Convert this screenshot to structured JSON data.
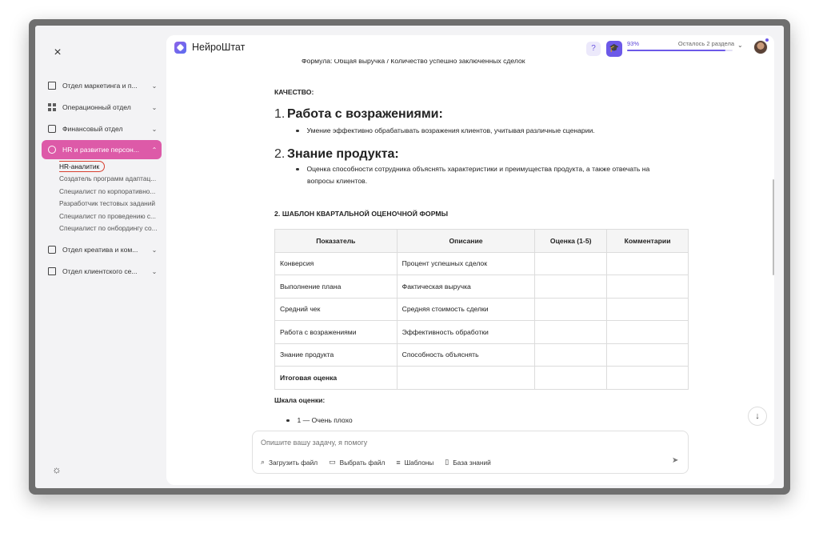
{
  "sidebar": {
    "close_icon": "×",
    "items": [
      {
        "label": "Отдел маркетинга и п...",
        "icon": "shop-icon"
      },
      {
        "label": "Операционный отдел",
        "icon": "grid-icon"
      },
      {
        "label": "Финансовый отдел",
        "icon": "wallet-icon"
      },
      {
        "label": "HR и развитие персон...",
        "icon": "users-icon",
        "active": true
      },
      {
        "label": "Отдел креатива и ком...",
        "icon": "chat-icon"
      },
      {
        "label": "Отдел клиентского се...",
        "icon": "card-icon"
      }
    ],
    "sub_items": [
      "HR-аналитик",
      "Создатель программ адаптац...",
      "Специалист по корпоративно...",
      "Разработчик тестовых заданий",
      "Специалист по проведению с...",
      "Специалист по онбордингу со..."
    ]
  },
  "topbar": {
    "brand": "НейроШтат",
    "progress_pct": "93%",
    "progress_value": 0.93,
    "progress_left": "Осталось 2 раздела"
  },
  "content": {
    "cut_line": "Формула: Общая выручка / Количество успешно заключенных сделок",
    "quality_heading": "КАЧЕСТВО:",
    "item1_num": "1.",
    "item1_title": "Работа с возражениями:",
    "item1_bullet": "Умение эффективно обрабатывать возражения клиентов, учитывая различные сценарии.",
    "item2_num": "2.",
    "item2_title": "Знание продукта:",
    "item2_bullet_line1": "Оценка способности сотрудника объяснять характеристики и преимущества продукта, а также отвечать на",
    "item2_bullet_line2": "вопросы клиентов.",
    "section_heading": "2. ШАБЛОН КВАРТАЛЬНОЙ ОЦЕНОЧНОЙ ФОРМЫ",
    "table": {
      "headers": [
        "Показатель",
        "Описание",
        "Оценка (1-5)",
        "Комментарии"
      ],
      "rows": [
        [
          "Конверсия",
          "Процент успешных сделок",
          "",
          ""
        ],
        [
          "Выполнение плана",
          "Фактическая выручка",
          "",
          ""
        ],
        [
          "Средний чек",
          "Средняя стоимость сделки",
          "",
          ""
        ],
        [
          "Работа с возражениями",
          "Эффективность обработки",
          "",
          ""
        ],
        [
          "Знание продукта",
          "Способность объяснять",
          "",
          ""
        ],
        [
          "Итоговая оценка",
          "",
          "",
          ""
        ]
      ]
    },
    "scale_title": "Шкала оценки:",
    "scale_item": "1 — Очень плохо"
  },
  "composer": {
    "placeholder": "Опишите вашу задачу, я помогу",
    "upload": "Загрузить файл",
    "choose": "Выбрать файл",
    "templates": "Шаблоны",
    "knowledge": "База знаний"
  }
}
